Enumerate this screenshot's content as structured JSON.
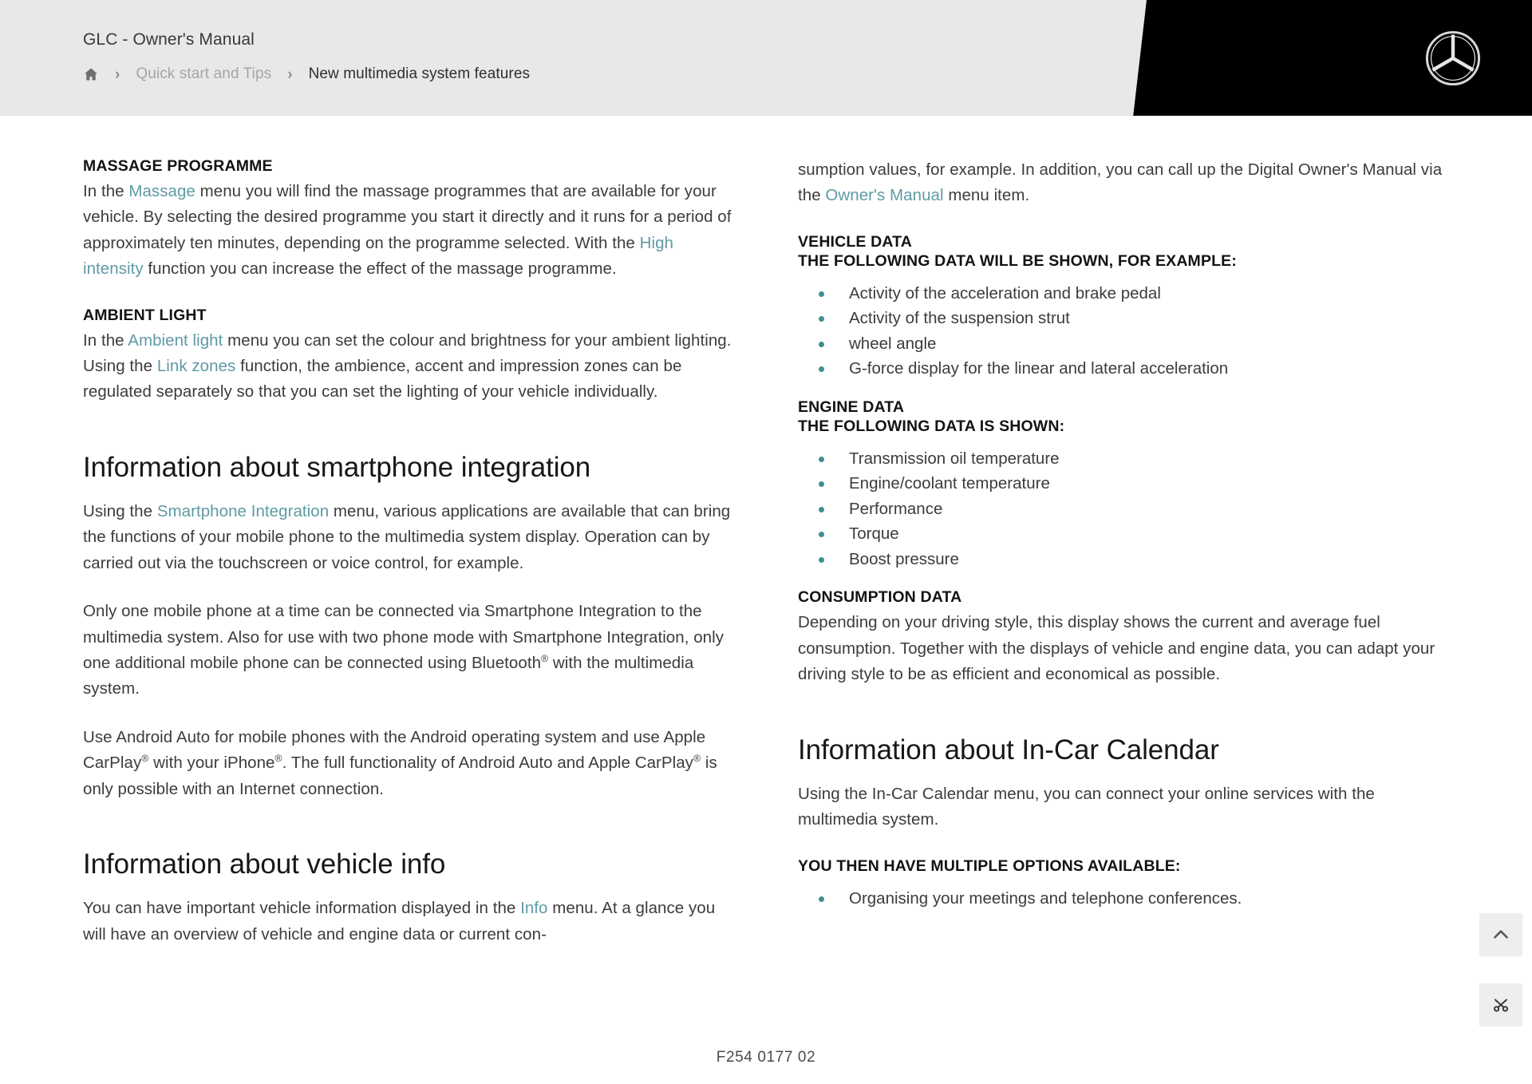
{
  "header": {
    "manual_title": "GLC - Owner's Manual",
    "breadcrumb": {
      "home_icon": "home-icon",
      "separator": "›",
      "items": [
        {
          "label": "Quick start and Tips",
          "current": false
        },
        {
          "label": "New multimedia system features",
          "current": true
        }
      ]
    },
    "logo": "mercedes-benz-star-logo",
    "colors": {
      "band": "#000000",
      "background": "#e8e8e8"
    }
  },
  "left_column": {
    "massage": {
      "heading": "MASSAGE PROGRAMME",
      "text_1": "In the ",
      "link_1": "Massage",
      "text_2": " menu you will find the massage programmes that are available for your vehicle. By selecting the desired programme you start it directly and it runs for a period of approximately ten minutes, depending on the programme selected. With the ",
      "link_2": "High intensity",
      "text_3": " function you can increase the effect of the massage programme."
    },
    "ambient": {
      "heading": "AMBIENT LIGHT",
      "text_1": "In the ",
      "link_1": "Ambient light",
      "text_2": " menu you can set the colour and brightness for your ambient lighting. Using the ",
      "link_2": "Link zones",
      "text_3": " function, the ambience, accent and impression zones can be regulated separately so that you can set the lighting of your vehicle individually."
    },
    "smartphone": {
      "heading": "Information about smartphone integration",
      "para_1_text_1": "Using the ",
      "para_1_link": "Smartphone Integration",
      "para_1_text_2": " menu, various applications are available that can bring the functions of your mobile phone to the multimedia system display. Operation can by carried out via the touchscreen or voice control, for example.",
      "para_2": "Only one mobile phone at a time can be connected via Smartphone Integration to the multimedia system. Also for use with two phone mode with Smartphone Integration, only one additional mobile phone can be connected using Bluetooth",
      "para_2_sup": "®",
      "para_2_end": " with the multimedia system.",
      "para_3_a": "Use Android Auto for mobile phones with the Android operating system and use Apple CarPlay",
      "para_3_sup1": "®",
      "para_3_b": " with your iPhone",
      "para_3_sup2": "®",
      "para_3_c": ". The full functionality of Android Auto and Apple CarPlay",
      "para_3_sup3": "®",
      "para_3_d": " is only possible with an Internet connection."
    },
    "vehicle_info": {
      "heading": "Information about vehicle info",
      "text_1": "You can have important vehicle information displayed in the ",
      "link_1": "Info",
      "text_2": " menu. At a glance you will have an overview of vehicle and engine data or current con-"
    }
  },
  "right_column": {
    "continued": {
      "text_1": "sumption values, for example. In addition, you can call up the Digital Owner's Manual via the ",
      "link_1": "Owner's Manual",
      "text_2": " menu item."
    },
    "vehicle_data": {
      "heading": "VEHICLE DATA",
      "subheading": "THE FOLLOWING DATA WILL BE SHOWN, FOR EXAMPLE:",
      "items": [
        "Activity of the acceleration and brake pedal",
        "Activity of the suspension strut",
        "wheel angle",
        "G-force display for the linear and lateral acceleration"
      ]
    },
    "engine_data": {
      "heading": "ENGINE DATA",
      "subheading": "THE FOLLOWING DATA IS SHOWN:",
      "items": [
        "Transmission oil temperature",
        "Engine/coolant temperature",
        "Performance",
        "Torque",
        "Boost pressure"
      ]
    },
    "consumption_data": {
      "heading": "CONSUMPTION DATA",
      "text": "Depending on your driving style, this display shows the current and average fuel consumption. Together with the displays of vehicle and engine data, you can adapt your driving style to be as efficient and economical as possible."
    },
    "calendar": {
      "heading": "Information about In-Car Calendar",
      "text": "Using the In-Car Calendar menu, you can connect your online services with the multimedia system.",
      "subheading": "YOU THEN HAVE MULTIPLE OPTIONS AVAILABLE:",
      "items": [
        "Organising your meetings and telephone conferences."
      ]
    }
  },
  "footer": {
    "page_code": "F254 0177 02"
  },
  "floating_buttons": [
    {
      "name": "scroll-to-top-button",
      "icon": "chevron-up-icon"
    },
    {
      "name": "expand-collapse-button",
      "icon": "scissors-icon"
    }
  ],
  "colors": {
    "link": "#5e9aa5",
    "bullet": "#3f8f91",
    "body_text": "#3c3c3c",
    "heading_text": "#171717"
  }
}
